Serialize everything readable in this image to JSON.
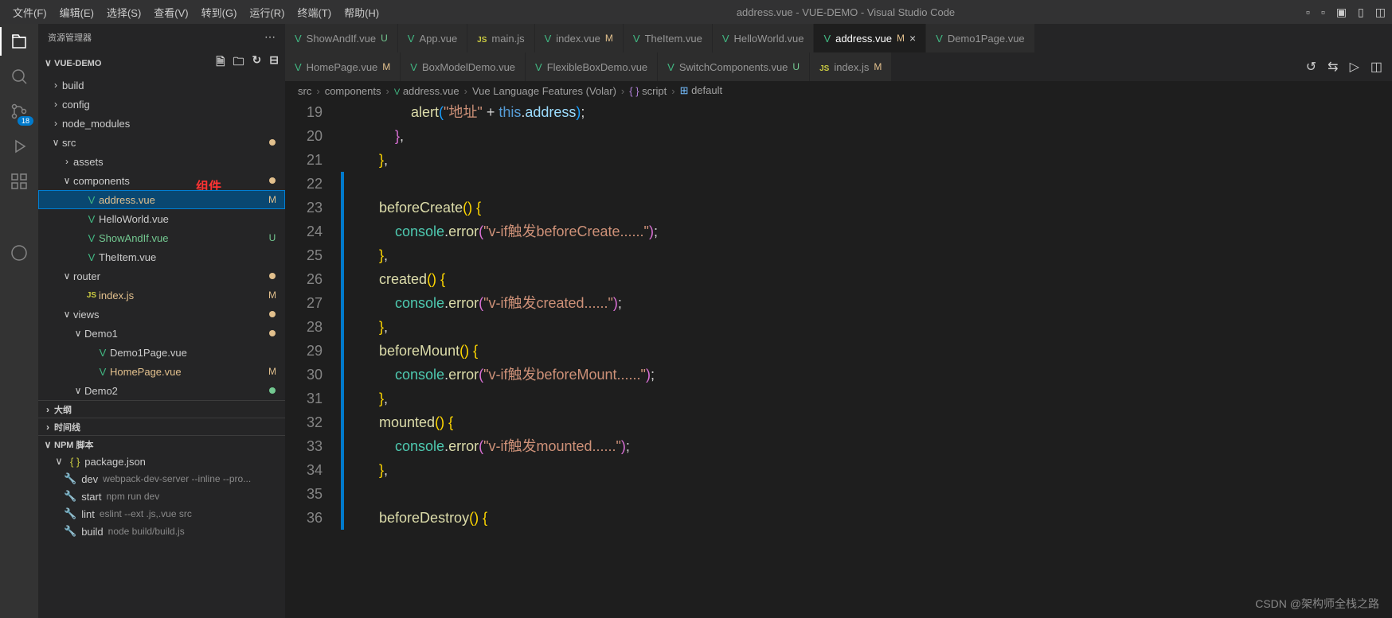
{
  "window_title": "address.vue - VUE-DEMO - Visual Studio Code",
  "menubar": [
    "文件(F)",
    "编辑(E)",
    "选择(S)",
    "查看(V)",
    "转到(G)",
    "运行(R)",
    "终端(T)",
    "帮助(H)"
  ],
  "activitybar_badge": "18",
  "sidebar": {
    "title": "资源管理器",
    "project": "VUE-DEMO",
    "tree": [
      {
        "indent": 1,
        "chev": ">",
        "label": "build",
        "cls": ""
      },
      {
        "indent": 1,
        "chev": ">",
        "label": "config",
        "cls": ""
      },
      {
        "indent": 1,
        "chev": ">",
        "label": "node_modules",
        "cls": ""
      },
      {
        "indent": 1,
        "chev": "v",
        "label": "src",
        "cls": "",
        "dot": "orange"
      },
      {
        "indent": 2,
        "chev": ">",
        "label": "assets",
        "cls": ""
      },
      {
        "indent": 2,
        "chev": "v",
        "label": "components",
        "cls": "",
        "dot": "orange"
      },
      {
        "indent": 3,
        "icon": "vue",
        "label": "address.vue",
        "cls": "orange",
        "status": "M",
        "selected": true
      },
      {
        "indent": 3,
        "icon": "vue",
        "label": "HelloWorld.vue",
        "cls": ""
      },
      {
        "indent": 3,
        "icon": "vue",
        "label": "ShowAndIf.vue",
        "cls": "green",
        "status": "U"
      },
      {
        "indent": 3,
        "icon": "vue",
        "label": "TheItem.vue",
        "cls": ""
      },
      {
        "indent": 2,
        "chev": "v",
        "label": "router",
        "cls": "",
        "dot": "orange"
      },
      {
        "indent": 3,
        "icon": "js",
        "label": "index.js",
        "cls": "orange",
        "status": "M"
      },
      {
        "indent": 2,
        "chev": "v",
        "label": "views",
        "cls": "",
        "dot": "orange"
      },
      {
        "indent": 3,
        "chev": "v",
        "label": "Demo1",
        "cls": "",
        "dot": "orange"
      },
      {
        "indent": 4,
        "icon": "vue",
        "label": "Demo1Page.vue",
        "cls": ""
      },
      {
        "indent": 4,
        "icon": "vue",
        "label": "HomePage.vue",
        "cls": "orange",
        "status": "M"
      },
      {
        "indent": 3,
        "chev": "v",
        "label": "Demo2",
        "cls": "",
        "dot": "green"
      }
    ],
    "sections": [
      {
        "chev": ">",
        "label": "大纲"
      },
      {
        "chev": ">",
        "label": "时间线"
      },
      {
        "chev": "v",
        "label": "NPM 脚本"
      }
    ],
    "npm_package": "package.json",
    "npm_scripts": [
      {
        "name": "dev",
        "cmd": "webpack-dev-server --inline --pro..."
      },
      {
        "name": "start",
        "cmd": "npm run dev"
      },
      {
        "name": "lint",
        "cmd": "eslint --ext .js,.vue src"
      },
      {
        "name": "build",
        "cmd": "node build/build.js"
      }
    ]
  },
  "annotation_text": "组件",
  "tabs_row1": [
    {
      "icon": "vue",
      "label": "ShowAndIf.vue",
      "status": "U"
    },
    {
      "icon": "vue",
      "label": "App.vue"
    },
    {
      "icon": "js",
      "label": "main.js"
    },
    {
      "icon": "vue",
      "label": "index.vue",
      "status": "M"
    },
    {
      "icon": "vue",
      "label": "TheItem.vue"
    },
    {
      "icon": "vue",
      "label": "HelloWorld.vue"
    },
    {
      "icon": "vue",
      "label": "address.vue",
      "status": "M",
      "active": true,
      "close": true
    },
    {
      "icon": "vue",
      "label": "Demo1Page.vue"
    }
  ],
  "tabs_row2": [
    {
      "icon": "vue",
      "label": "HomePage.vue",
      "status": "M"
    },
    {
      "icon": "vue",
      "label": "BoxModelDemo.vue"
    },
    {
      "icon": "vue",
      "label": "FlexibleBoxDemo.vue"
    },
    {
      "icon": "vue",
      "label": "SwitchComponents.vue",
      "status": "U"
    },
    {
      "icon": "js",
      "label": "index.js",
      "status": "M"
    }
  ],
  "breadcrumb": [
    "src",
    "components",
    "address.vue",
    "Vue Language Features (Volar)",
    "script",
    "default"
  ],
  "code_lines": [
    {
      "n": 19,
      "tokens": [
        [
          "            ",
          ""
        ],
        [
          "alert",
          "c-fn"
        ],
        [
          "(",
          "c-brace3"
        ],
        [
          "\"地址\"",
          "c-str"
        ],
        [
          " + ",
          "c-punct"
        ],
        [
          "this",
          "c-kw"
        ],
        [
          ".",
          "c-punct"
        ],
        [
          "address",
          "c-prop"
        ],
        [
          ")",
          "c-brace3"
        ],
        [
          ";",
          "c-punct"
        ]
      ]
    },
    {
      "n": 20,
      "tokens": [
        [
          "        ",
          ""
        ],
        [
          "}",
          "c-brace2"
        ],
        [
          ",",
          "c-punct"
        ]
      ]
    },
    {
      "n": 21,
      "tokens": [
        [
          "    ",
          ""
        ],
        [
          "}",
          "c-brace"
        ],
        [
          ",",
          "c-punct"
        ]
      ]
    },
    {
      "n": 22,
      "tokens": [
        [
          "",
          ""
        ]
      ],
      "git": "mod"
    },
    {
      "n": 23,
      "tokens": [
        [
          "    ",
          ""
        ],
        [
          "beforeCreate",
          "c-fn"
        ],
        [
          "()",
          "c-brace"
        ],
        [
          " ",
          ""
        ],
        [
          "{",
          "c-brace"
        ]
      ],
      "git": "mod"
    },
    {
      "n": 24,
      "tokens": [
        [
          "        ",
          ""
        ],
        [
          "console",
          "c-obj"
        ],
        [
          ".",
          "c-punct"
        ],
        [
          "error",
          "c-fn"
        ],
        [
          "(",
          "c-brace2"
        ],
        [
          "\"v-if触发beforeCreate......\"",
          "c-str"
        ],
        [
          ")",
          "c-brace2"
        ],
        [
          ";",
          "c-punct"
        ]
      ],
      "git": "mod"
    },
    {
      "n": 25,
      "tokens": [
        [
          "    ",
          ""
        ],
        [
          "}",
          "c-brace"
        ],
        [
          ",",
          "c-punct"
        ]
      ],
      "git": "mod"
    },
    {
      "n": 26,
      "tokens": [
        [
          "    ",
          ""
        ],
        [
          "created",
          "c-fn"
        ],
        [
          "()",
          "c-brace"
        ],
        [
          " ",
          ""
        ],
        [
          "{",
          "c-brace"
        ]
      ],
      "git": "mod"
    },
    {
      "n": 27,
      "tokens": [
        [
          "        ",
          ""
        ],
        [
          "console",
          "c-obj"
        ],
        [
          ".",
          "c-punct"
        ],
        [
          "error",
          "c-fn"
        ],
        [
          "(",
          "c-brace2"
        ],
        [
          "\"v-if触发created......\"",
          "c-str"
        ],
        [
          ")",
          "c-brace2"
        ],
        [
          ";",
          "c-punct"
        ]
      ],
      "git": "mod"
    },
    {
      "n": 28,
      "tokens": [
        [
          "    ",
          ""
        ],
        [
          "}",
          "c-brace"
        ],
        [
          ",",
          "c-punct"
        ]
      ],
      "git": "mod"
    },
    {
      "n": 29,
      "tokens": [
        [
          "    ",
          ""
        ],
        [
          "beforeMount",
          "c-fn"
        ],
        [
          "()",
          "c-brace"
        ],
        [
          " ",
          ""
        ],
        [
          "{",
          "c-brace"
        ]
      ],
      "git": "mod"
    },
    {
      "n": 30,
      "tokens": [
        [
          "        ",
          ""
        ],
        [
          "console",
          "c-obj"
        ],
        [
          ".",
          "c-punct"
        ],
        [
          "error",
          "c-fn"
        ],
        [
          "(",
          "c-brace2"
        ],
        [
          "\"v-if触发beforeMount......\"",
          "c-str"
        ],
        [
          ")",
          "c-brace2"
        ],
        [
          ";",
          "c-punct"
        ]
      ],
      "git": "mod"
    },
    {
      "n": 31,
      "tokens": [
        [
          "    ",
          ""
        ],
        [
          "}",
          "c-brace"
        ],
        [
          ",",
          "c-punct"
        ]
      ],
      "git": "mod"
    },
    {
      "n": 32,
      "tokens": [
        [
          "    ",
          ""
        ],
        [
          "mounted",
          "c-fn"
        ],
        [
          "()",
          "c-brace"
        ],
        [
          " ",
          ""
        ],
        [
          "{",
          "c-brace"
        ]
      ],
      "git": "mod"
    },
    {
      "n": 33,
      "tokens": [
        [
          "        ",
          ""
        ],
        [
          "console",
          "c-obj"
        ],
        [
          ".",
          "c-punct"
        ],
        [
          "error",
          "c-fn"
        ],
        [
          "(",
          "c-brace2"
        ],
        [
          "\"v-if触发mounted......\"",
          "c-str"
        ],
        [
          ")",
          "c-brace2"
        ],
        [
          ";",
          "c-punct"
        ]
      ],
      "git": "mod"
    },
    {
      "n": 34,
      "tokens": [
        [
          "    ",
          ""
        ],
        [
          "}",
          "c-brace"
        ],
        [
          ",",
          "c-punct"
        ]
      ],
      "git": "mod"
    },
    {
      "n": 35,
      "tokens": [
        [
          "",
          ""
        ]
      ],
      "git": "mod"
    },
    {
      "n": 36,
      "tokens": [
        [
          "    ",
          ""
        ],
        [
          "beforeDestroy",
          "c-fn"
        ],
        [
          "()",
          "c-brace"
        ],
        [
          " ",
          ""
        ],
        [
          "{",
          "c-brace"
        ]
      ],
      "git": "mod"
    }
  ],
  "watermark": "CSDN @架构师全栈之路"
}
